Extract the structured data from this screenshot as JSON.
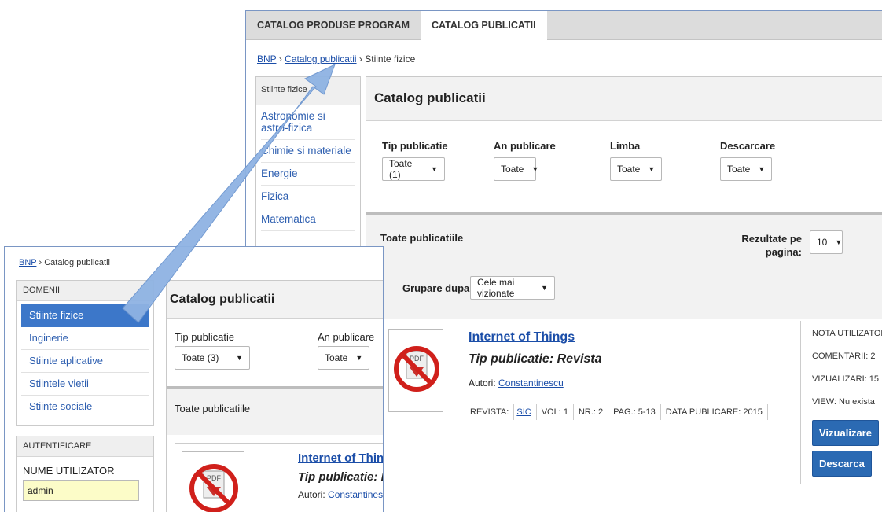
{
  "back": {
    "tabs": [
      {
        "label": "CATALOG PRODUSE PROGRAM"
      },
      {
        "label": "CATALOG PUBLICATII"
      }
    ],
    "breadcrumb": {
      "home": "BNP",
      "sep1": "›",
      "catalog": "Catalog publicatii",
      "sep2": "›",
      "current": "Stiinte fizice"
    },
    "sidebar": {
      "header": "Stiinte fizice",
      "items": [
        {
          "label": "Astronomie si astro-fizica"
        },
        {
          "label": "Chimie si materiale"
        },
        {
          "label": "Energie"
        },
        {
          "label": "Fizica"
        },
        {
          "label": "Matematica"
        }
      ]
    },
    "main": {
      "title": "Catalog publicatii",
      "filters": {
        "tip": {
          "label": "Tip publicatie",
          "value": "Toate (1)"
        },
        "an": {
          "label": "An publicare",
          "value": "Toate"
        },
        "limba": {
          "label": "Limba",
          "value": "Toate"
        },
        "descarcare": {
          "label": "Descarcare",
          "value": "Toate"
        }
      },
      "all_label": "Toate publicatiile",
      "results_label": "Rezultate pe pagina:",
      "results_value": "10",
      "group_label": "Grupare dupa:",
      "group_value": "Cele mai vizionate",
      "item": {
        "title": "Internet of Things",
        "type": "Tip publicatie: Revista",
        "authors_label": "Autori:",
        "author": "Constantinescu",
        "meta": {
          "revista_label": "REVISTA:",
          "revista_value": "SIC",
          "vol": "VOL: 1",
          "nr": "NR.: 2",
          "pag": "PAG.: 5-13",
          "data": "DATA PUBLICARE: 2015"
        },
        "stats": {
          "nota": "NOTA UTILIZATOR",
          "comentarii": "COMENTARII: 2",
          "vizualizari": "VIZUALIZARI: 15",
          "view": "VIEW: Nu exista"
        },
        "btn_view": "Vizualizare",
        "btn_download": "Descarca"
      }
    }
  },
  "front": {
    "breadcrumb": {
      "home": "BNP",
      "sep": "›",
      "current": "Catalog publicatii"
    },
    "domains": {
      "header": "DOMENII",
      "items": [
        {
          "label": "Stiinte fizice"
        },
        {
          "label": "Inginerie"
        },
        {
          "label": "Stiinte aplicative"
        },
        {
          "label": "Stiintele vietii"
        },
        {
          "label": "Stiinte sociale"
        }
      ]
    },
    "auth": {
      "header": "AUTENTIFICARE",
      "user_label": "NUME UTILIZATOR",
      "user_value": "admin"
    },
    "main": {
      "title": "Catalog publicatii",
      "tip": {
        "label": "Tip publicatie",
        "value": "Toate (3)"
      },
      "an": {
        "label": "An publicare",
        "value": "Toate"
      },
      "all_label": "Toate publicatiile",
      "item": {
        "title": "Internet of Things",
        "type": "Tip publicatie: Revista",
        "authors_label": "Autori:",
        "author": "Constantinescu"
      }
    }
  },
  "icons": {
    "pdf": "pdf-icon-crossed",
    "dropdown": "chevron-down-icon"
  },
  "colors": {
    "accent": "#3c77c9",
    "arrow": "#8fb3e3",
    "button": "#2b6ab3",
    "link": "#1a4da8"
  }
}
